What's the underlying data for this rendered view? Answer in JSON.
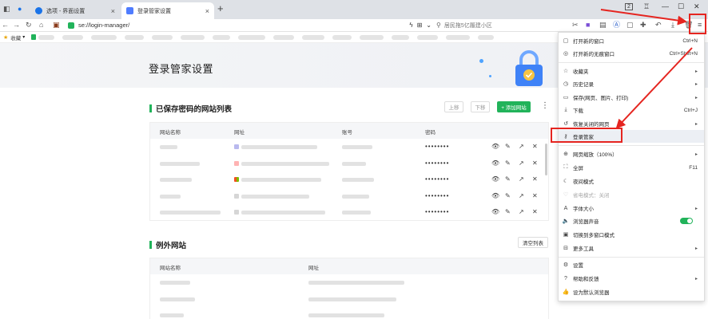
{
  "tabs": [
    {
      "label": "选项 - 界面设置"
    },
    {
      "label": "登录管家设置"
    }
  ],
  "window_controls": {
    "badge": "2"
  },
  "address": {
    "url": "se://login-manager/",
    "search_placeholder": "居民拖5亿履建小区"
  },
  "bookmarks": {
    "label": "收藏"
  },
  "page": {
    "title": "登录管家设置",
    "saved": {
      "title": "已保存密码的网站列表",
      "buttons": {
        "up": "上移",
        "down": "下移",
        "add": "+ 添加网站"
      },
      "columns": [
        "网站名称",
        "网址",
        "账号",
        "密码"
      ],
      "password_mask": "••••••••",
      "row_count": 5
    },
    "excluded": {
      "title": "例外网站",
      "clear_button": "清空列表",
      "columns": [
        "网站名称",
        "网址"
      ]
    }
  },
  "menu": {
    "items": [
      {
        "icon": "new-window-icon",
        "label": "打开新的窗口",
        "shortcut": "Ctrl+N"
      },
      {
        "icon": "incognito-icon",
        "label": "打开新的无痕窗口",
        "shortcut": "Ctrl+Shift+N"
      },
      {
        "icon": "star-icon",
        "label": "收藏夹",
        "arrow": "▸"
      },
      {
        "icon": "history-icon",
        "label": "历史记录",
        "arrow": "▸"
      },
      {
        "icon": "save-icon",
        "label": "保存(网页、图片、打印)",
        "arrow": "▸"
      },
      {
        "icon": "download-icon",
        "label": "下载",
        "shortcut": "Ctrl+J"
      },
      {
        "icon": "restore-icon",
        "label": "恢复关闭的网页",
        "arrow": "▸"
      },
      {
        "icon": "key-icon",
        "label": "登录管家"
      },
      {
        "icon": "zoom-icon",
        "label": "网页缩放（100%）",
        "arrow": "▸"
      },
      {
        "icon": "fullscreen-icon",
        "label": "全屏",
        "shortcut": "F11"
      },
      {
        "icon": "night-mode-icon",
        "label": "夜间模式"
      },
      {
        "icon": "eye-care-icon",
        "label": "省电模式：关闭"
      },
      {
        "icon": "font-size-icon",
        "label": "字体大小",
        "arrow": "▸"
      },
      {
        "icon": "sound-icon",
        "label": "浏览器声音"
      },
      {
        "icon": "multi-window-icon",
        "label": "切换到多窗口模式"
      },
      {
        "icon": "tools-icon",
        "label": "更多工具",
        "arrow": "▸"
      },
      {
        "icon": "settings-icon",
        "label": "设置"
      },
      {
        "icon": "help-icon",
        "label": "帮助和反馈",
        "arrow": "▸"
      },
      {
        "icon": "thumbs-up-icon",
        "label": "设为默认浏览器"
      }
    ]
  },
  "colors": {
    "accent": "#21b35a",
    "highlight": "#e52520"
  }
}
